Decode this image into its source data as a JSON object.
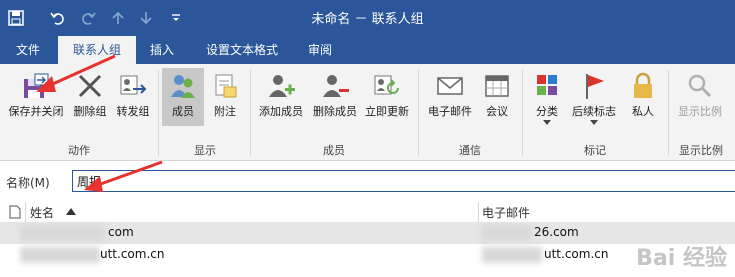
{
  "window": {
    "title": "未命名 － 联系人组"
  },
  "colors": {
    "title_bg": "#2b579a",
    "ribbon_bg": "#f3f3f3",
    "annotation_arrow": "#e8322f"
  },
  "quick_access": [
    "save-icon",
    "undo-icon",
    "redo-icon",
    "up-icon",
    "down-icon",
    "customize-icon"
  ],
  "tabs": [
    {
      "label": "文件",
      "active": false
    },
    {
      "label": "联系人组",
      "active": true
    },
    {
      "label": "插入",
      "active": false
    },
    {
      "label": "设置文本格式",
      "active": false
    },
    {
      "label": "审阅",
      "active": false
    }
  ],
  "ribbon": {
    "groups": {
      "actions": "动作",
      "show": "显示",
      "members": "成员",
      "communicate": "通信",
      "tags": "标记",
      "zoom": "显示比例"
    },
    "buttons": {
      "save_close": "保存并关闭",
      "delete_group": "删除组",
      "forward_group": "转发组",
      "members": "成员",
      "notes": "附注",
      "add_members": "添加成员",
      "remove_member": "删除成员",
      "update_now": "立即更新",
      "email": "电子邮件",
      "meeting": "会议",
      "categorize": "分类",
      "follow_up": "后续标志",
      "private": "私人",
      "zoom": "显示比例"
    }
  },
  "name_field": {
    "label": "名称(M)",
    "value": "周报"
  },
  "list": {
    "columns": [
      "姓名",
      "电子邮件"
    ],
    "rows": [
      {
        "name": "com",
        "email": "26.com"
      },
      {
        "name": "utt.com.cn",
        "email": "utt.com.cn"
      }
    ]
  },
  "watermark": "Bai 经验"
}
